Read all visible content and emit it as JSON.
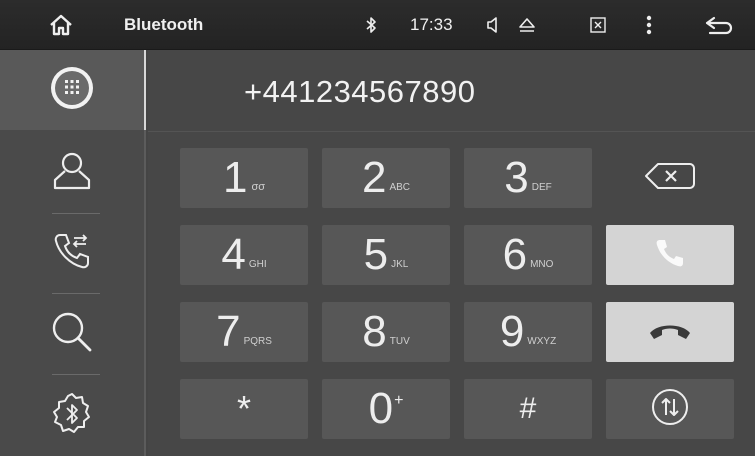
{
  "topbar": {
    "app_title": "Bluetooth",
    "clock": "17:33",
    "icons": [
      "home-icon",
      "bluetooth-status-icon",
      "volume-icon",
      "eject-icon",
      "close-window-icon",
      "more-menu-icon",
      "back-icon"
    ]
  },
  "sidebar": {
    "items": [
      {
        "name": "dialpad",
        "icon": "dialpad-icon",
        "active": true
      },
      {
        "name": "contacts",
        "icon": "contacts-icon",
        "active": false
      },
      {
        "name": "call-log",
        "icon": "call-log-icon",
        "active": false
      },
      {
        "name": "search",
        "icon": "search-icon",
        "active": false
      },
      {
        "name": "bluetooth-settings",
        "icon": "bluetooth-settings-icon",
        "active": false
      }
    ]
  },
  "dialer": {
    "number": "+441234567890",
    "keys": [
      {
        "digit": "1",
        "letters": "σσ"
      },
      {
        "digit": "2",
        "letters": "ABC"
      },
      {
        "digit": "3",
        "letters": "DEF"
      },
      {
        "digit": "4",
        "letters": "GHI"
      },
      {
        "digit": "5",
        "letters": "JKL"
      },
      {
        "digit": "6",
        "letters": "MNO"
      },
      {
        "digit": "7",
        "letters": "PQRS"
      },
      {
        "digit": "8",
        "letters": "TUV"
      },
      {
        "digit": "9",
        "letters": "WXYZ"
      },
      {
        "digit": "*",
        "letters": ""
      },
      {
        "digit": "0",
        "letters": "+"
      },
      {
        "digit": "#",
        "letters": ""
      }
    ],
    "actions": [
      "backspace-icon",
      "call-icon",
      "hang-up-icon",
      "switch-audio-icon"
    ]
  },
  "colors": {
    "topbar": "#262626",
    "background": "#454545",
    "key": "#575757",
    "accent_light": "#d4d4d4"
  }
}
